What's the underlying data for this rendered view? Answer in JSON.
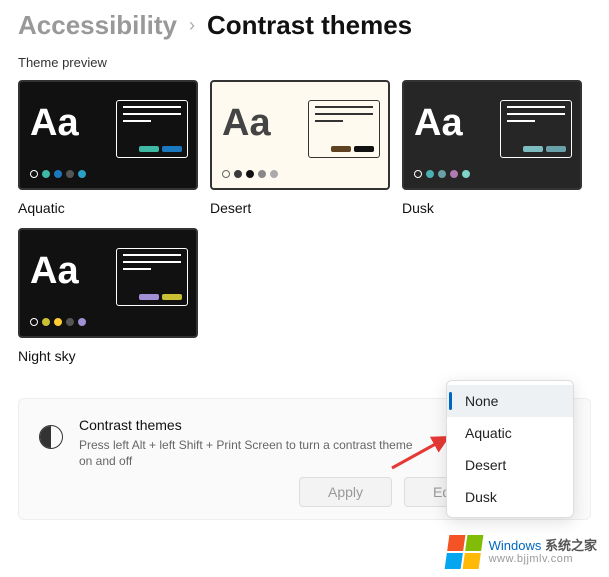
{
  "header": {
    "parent": "Accessibility",
    "current": "Contrast themes"
  },
  "section_label": "Theme preview",
  "themes": [
    {
      "name": "Aquatic",
      "aa": "Aa"
    },
    {
      "name": "Desert",
      "aa": "Aa"
    },
    {
      "name": "Dusk",
      "aa": "Aa"
    },
    {
      "name": "Night sky",
      "aa": "Aa"
    }
  ],
  "panel": {
    "title": "Contrast themes",
    "subtitle": "Press left Alt + left Shift + Print Screen to turn a contrast theme on and off",
    "apply_label": "Apply",
    "edit_label": "Edit"
  },
  "dropdown": {
    "items": [
      "None",
      "Aquatic",
      "Desert",
      "Dusk"
    ],
    "selected": "None"
  },
  "watermark": {
    "brand_en": "Windows",
    "brand_cn": "系统之家",
    "url": "www.bjjmlv.com"
  }
}
